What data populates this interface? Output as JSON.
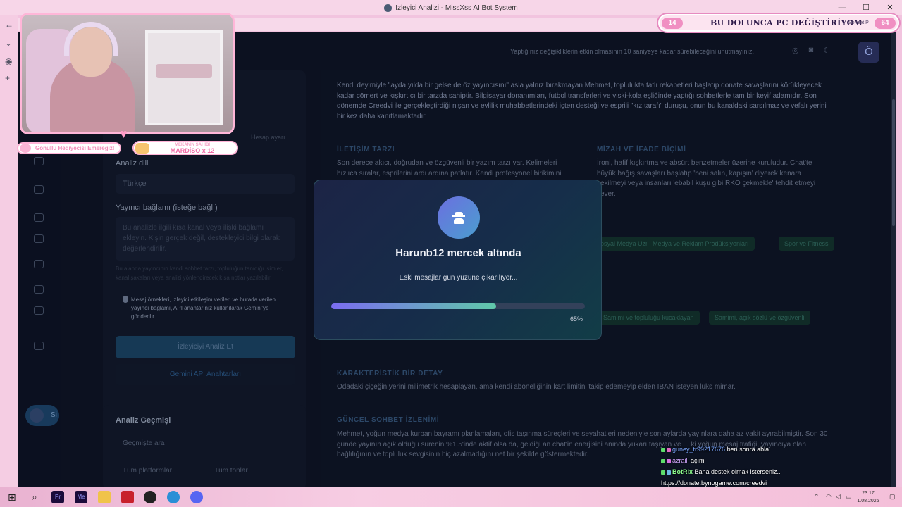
{
  "window": {
    "title": "İzleyici Analizi - MissXss AI Bot System"
  },
  "topbar": {
    "notice": "Yaptığınız değişikliklerin etkin olmasının 10 saniyeye kadar sürebileceğini unutmayınız.",
    "avatar_initial": "Ö"
  },
  "sidebar": {
    "user_button_label": "Si"
  },
  "left_panel": {
    "faded_subtitle": "Hesap ayarı",
    "language_label": "Analiz dili",
    "language_value": "Türkçe",
    "context_label": "Yayıncı bağlamı (isteğe bağlı)",
    "context_placeholder": "Bu analizle ilgili kısa kanal veya ilişki bağlamı ekleyin. Kişin gerçek değil, destekleyici bilgi olarak değerlendirilir.",
    "context_hint": "Bu alanda yayıncının kendi sohbet tarzı, topluluğun tanıdığı isimler, kanal şakaları veya analizi yönlendirecek kısa notlar yazılabilir.",
    "privacy_note": "Mesaj örnekleri, izleyici etkileşim verileri ve burada verilen yayıncı bağlamı, API anahtarınız kullanılarak Gemini'ye gönderilir.",
    "analyze_button": "İzleyiciyi Analiz Et",
    "keys_button": "Gemini API Anahtarları"
  },
  "history": {
    "title": "Analiz Geçmişi",
    "search_placeholder": "Geçmişte ara",
    "platform_filter": "Tüm platformlar",
    "tone_filter": "Tüm tonlar"
  },
  "report": {
    "intro": "Kendi deyimiyle \"ayda yılda bir gelse de öz yayıncısını\" asla yalnız bırakmayan Mehmet, toplulukta tatlı rekabetleri başlatıp donate savaşlarını körükleyecek kadar cömert ve kışkırtıcı bir tarzda sahiptir. Bilgisayar donanımları, futbol transferleri ve viski-kola eşliğinde yaptığı sohbetlerle tam bir keyif adamıdır. Son dönemde Creedvi ile gerçekleştirdiği nişan ve evlilik muhabbetlerindeki içten desteği ve esprili \"kız tarafı\" duruşu, onun bu kanaldaki sarsılmaz ve vefalı yerini bir kez daha kanıtlamaktadır.",
    "comm_title": "İLETİŞİM TARZI",
    "comm_text": "Son derece akıcı, doğrudan ve özgüvenli bir yazım tarzı var. Kelimeleri hızlıca sıralar, esprilerini ardı ardına patlatır. Kendi profesyonel birikimini",
    "humor_title": "MİZAH VE İFADE BİÇİMİ",
    "humor_text": "İroni, hafif kışkırtma ve absürt benzetmeler üzerine kuruludur. Chat'te büyük bağış savaşları başlatıp 'beni salın, kapışın' diyerek kenara çekilmeyi veya insanları 'ebabil kuşu gibi RKO çekmekle' tehdit etmeyi sever.",
    "interests": [
      "Sosyal Medya Uzmanları",
      "Medya ve Reklam Prodüksiyonları",
      "Spor ve Fitness"
    ],
    "traits": [
      "Samimi ve topluluğu kucaklayan",
      "Samimi, açık sözlü ve özgüvenli"
    ],
    "detail_title": "KARAKTERİSTİK BİR DETAY",
    "detail_text": "Odadaki çiçeğin yerini milimetrik hesaplayan, ama kendi aboneliğinin kart limitini takip edemeyip elden IBAN isteyen lüks mimar.",
    "chat_title": "GÜNCEL SOHBET İZLENİMİ",
    "chat_text": "Mehmet, yoğun medya kurban bayramı planlamaları, ofis taşınma süreçleri ve seyahatleri nedeniyle son aylarda yayınlara daha az vakit ayırabilmiştir. Son 30 günde yayının açık olduğu sürenin %1.5'inde aktif olsa da, geldiği an chat'in enerjisini anında yukarı taşıyan ve ... ki yoğun mesaj trafiği, yayıncıya olan bağlılığının ve topluluk sevgisinin hiç azalmadığını net bir şekilde göstermektedir."
  },
  "modal": {
    "title": "Harunb12 mercek altında",
    "subtitle": "Eski mesajlar gün yüzüne çıkarılıyor...",
    "progress_fraction": 0.65,
    "progress_label": "65%"
  },
  "overlay": {
    "badge_left": "Gönüllü Hediyecisi Emeregiz!",
    "badge_right_small": "MEKANIN SAHİBİ",
    "badge_right_main": "MARDİSO x 12",
    "goal_left": "14",
    "goal_text": "BU DOLUNCA PC DEĞİŞTİRİYOM",
    "goal_chip": "Sohbet P",
    "goal_right": "64"
  },
  "chat": [
    {
      "user": "guney_tr99217676",
      "message": " ben sonra abla"
    },
    {
      "user": "azraill",
      "message": " açım"
    },
    {
      "user": "BotRix",
      "message": " Bana destek olmak isterseniz.."
    },
    {
      "user": "",
      "message": "https://donate.bynogame.com/creedvi"
    }
  ],
  "taskbar": {
    "time": "23:17",
    "date": "1.08.2026"
  }
}
